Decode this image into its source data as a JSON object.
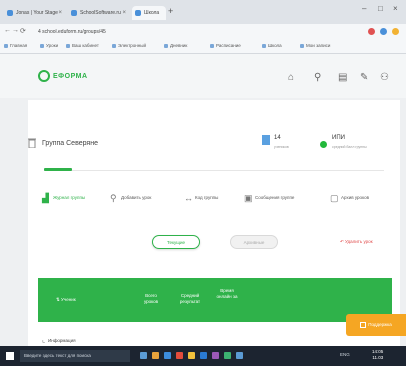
{
  "browser": {
    "tabs": [
      {
        "label": "Jonas | Your Stage"
      },
      {
        "label": "SchoolSoftware.ru"
      },
      {
        "label": "Школа"
      }
    ],
    "new_tab": "+",
    "address": "4 school.eduform.ru/groups/45",
    "bookmarks": [
      "Главная",
      "Уроки",
      "Ваш кабинет",
      "Электронный",
      "Дневник",
      "Расписание",
      "Школа",
      "Мои записи"
    ]
  },
  "app": {
    "logo_text": "ЕФОРМА",
    "group": {
      "title": "Группа Северяне",
      "stats": [
        {
          "value": "14",
          "label": "учеников"
        },
        {
          "value": "ИПИ",
          "label": "средний балл группы"
        }
      ]
    },
    "tabs": [
      {
        "label": "Журнал группы",
        "icon": "bar-chart-icon",
        "active": true
      },
      {
        "label": "Добавить урок",
        "icon": "location-pin-icon",
        "active": false
      },
      {
        "label": "Код группы",
        "icon": "arrows-icon",
        "active": false
      },
      {
        "label": "Сообщения группе",
        "icon": "document-icon",
        "active": false
      },
      {
        "label": "Архив уроков",
        "icon": "archive-icon",
        "active": false
      }
    ],
    "toggle": {
      "active": "Текущие",
      "inactive": "Архивные"
    },
    "delete_link": "Удалить урок",
    "table_columns": [
      "Ученик",
      "Всего уроков",
      "Средний результат",
      "Время онлайн за"
    ],
    "first_row": "Информация",
    "float_button": "Поддержка"
  },
  "taskbar": {
    "search_placeholder": "Введите здесь текст для поиска",
    "tray_text": "ENG",
    "clock_time": "14:05",
    "clock_date": "11.03"
  },
  "colors": {
    "accent": "#2fb24a",
    "warning": "#f5a623",
    "danger": "#e04a4a"
  }
}
